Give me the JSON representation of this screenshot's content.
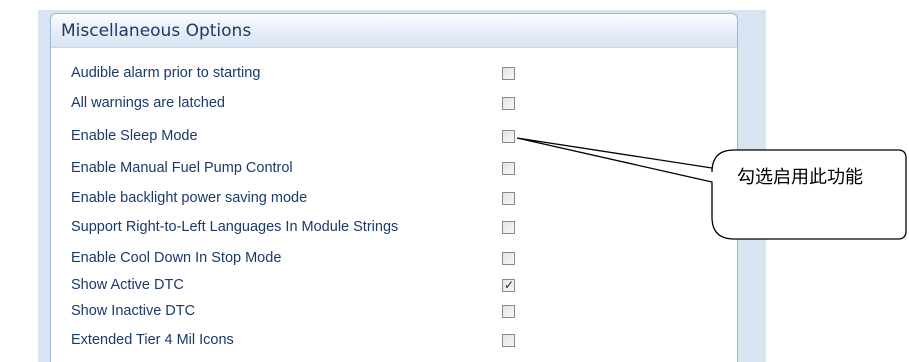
{
  "panel": {
    "title": "Miscellaneous Options"
  },
  "options": [
    {
      "label": "Audible alarm prior to starting",
      "checked": false
    },
    {
      "label": "All warnings are latched",
      "checked": false
    },
    {
      "label": "Enable Sleep Mode",
      "checked": false
    },
    {
      "label": "Enable Manual Fuel Pump Control",
      "checked": false
    },
    {
      "label": "Enable backlight power saving mode",
      "checked": false
    },
    {
      "label": "Support Right-to-Left Languages In Module Strings",
      "checked": false
    },
    {
      "label": "Enable Cool Down In Stop Mode",
      "checked": false
    },
    {
      "label": "Show Active DTC",
      "checked": true
    },
    {
      "label": "Show Inactive DTC",
      "checked": false
    },
    {
      "label": "Extended Tier 4 Mil Icons",
      "checked": false
    }
  ],
  "callout": {
    "text": "勾选启用此功能",
    "points_to": "Enable Sleep Mode"
  },
  "colors": {
    "label_text": "#1a3a6a",
    "title_text": "#1e3a66",
    "panel_border": "#9eb7d8",
    "outer_background": "#d8e4f2"
  }
}
